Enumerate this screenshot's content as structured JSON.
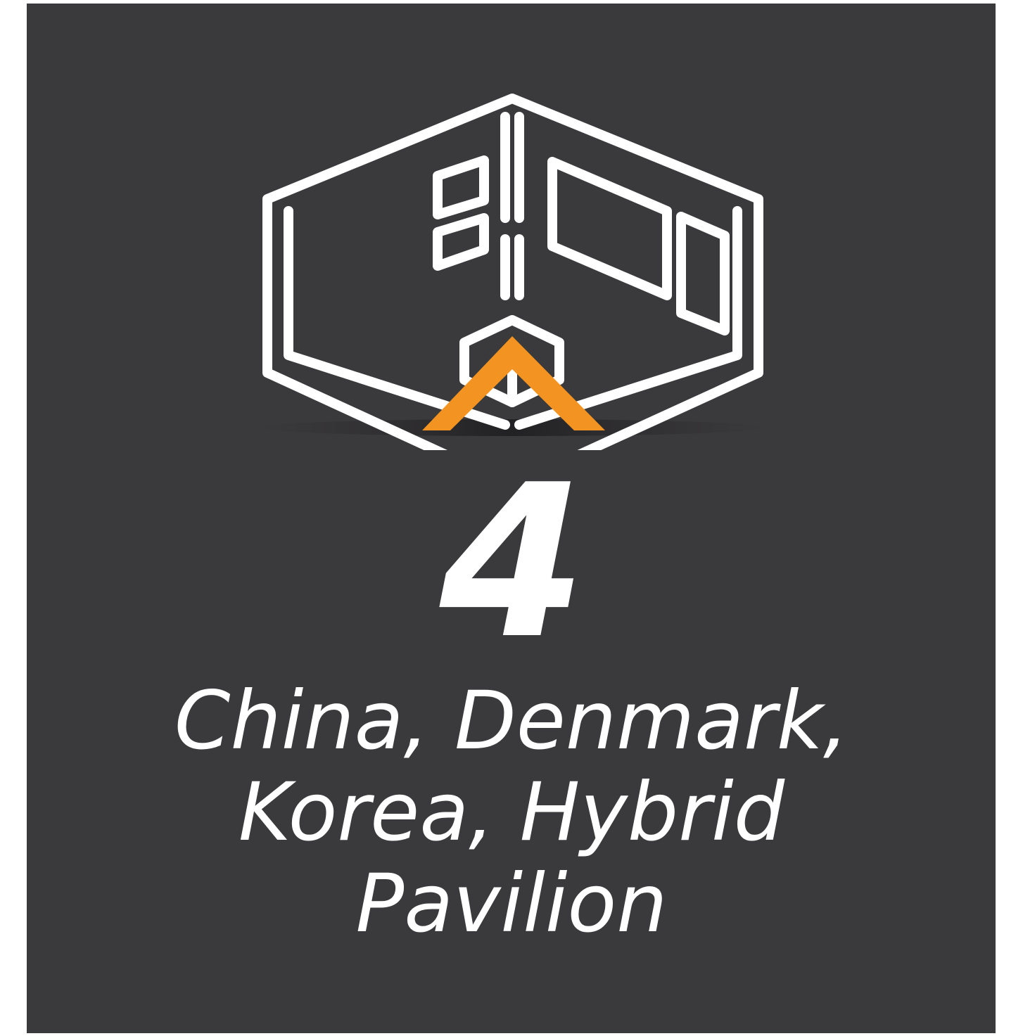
{
  "icon": "modular-building-icon",
  "colors": {
    "background": "#3a393b",
    "line": "#ffffff",
    "accent": "#f39422"
  },
  "count": "4",
  "caption_lines": [
    "China, Denmark,",
    "Korea, Hybrid",
    "Pavilion"
  ]
}
